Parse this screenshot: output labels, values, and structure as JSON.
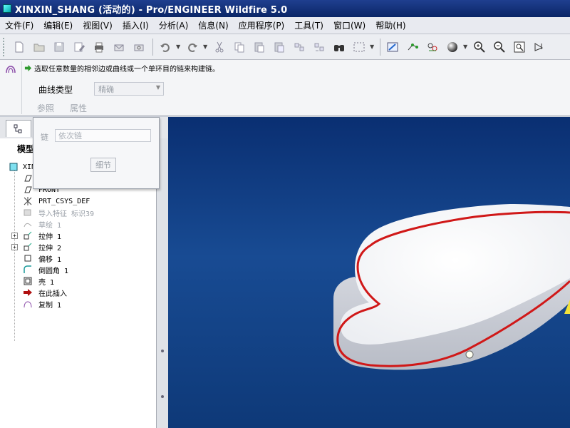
{
  "window": {
    "title": "XINXIN_SHANG (活动的) - Pro/ENGINEER Wildfire 5.0"
  },
  "menu": [
    "文件(F)",
    "编辑(E)",
    "视图(V)",
    "插入(I)",
    "分析(A)",
    "信息(N)",
    "应用程序(P)",
    "工具(T)",
    "窗口(W)",
    "帮助(H)"
  ],
  "dashboard": {
    "prompt": "选取任意数量的相邻边或曲线或一个单环目的链来构建链。",
    "curve_type_label": "曲线类型",
    "curve_type_value": "精确",
    "tab_references": "参照",
    "tab_properties": "属性"
  },
  "popup": {
    "chain_label": "链",
    "chain_placeholder": "依次链",
    "detail_button": "细节"
  },
  "model_tree": {
    "header": "模型",
    "root": "XINX",
    "items": [
      {
        "label": "TOP",
        "icon": "datum-plane-icon",
        "dim": false,
        "expand": false
      },
      {
        "label": "FRONT",
        "icon": "datum-plane-icon",
        "dim": false,
        "expand": false
      },
      {
        "label": "PRT_CSYS_DEF",
        "icon": "csys-icon",
        "dim": false,
        "expand": false
      },
      {
        "label": "导入特征 标识39",
        "icon": "import-feature-icon",
        "dim": true,
        "expand": false
      },
      {
        "label": "草绘 1",
        "icon": "sketch-icon",
        "dim": true,
        "expand": false
      },
      {
        "label": "拉伸 1",
        "icon": "extrude-icon",
        "dim": false,
        "expand": true
      },
      {
        "label": "拉伸 2",
        "icon": "extrude-icon",
        "dim": false,
        "expand": true
      },
      {
        "label": "偏移 1",
        "icon": "offset-icon",
        "dim": false,
        "expand": false
      },
      {
        "label": "倒圆角 1",
        "icon": "round-icon",
        "dim": false,
        "expand": false
      },
      {
        "label": "壳 1",
        "icon": "shell-icon",
        "dim": false,
        "expand": false
      },
      {
        "label": "在此插入",
        "icon": "insert-here-icon",
        "dim": false,
        "expand": false
      },
      {
        "label": "复制 1",
        "icon": "copy-feature-icon",
        "dim": false,
        "expand": false
      }
    ]
  },
  "colors": {
    "viewport_top": "#0a2f72",
    "edge_highlight": "#d01818",
    "title_bar": "#0a2566"
  }
}
